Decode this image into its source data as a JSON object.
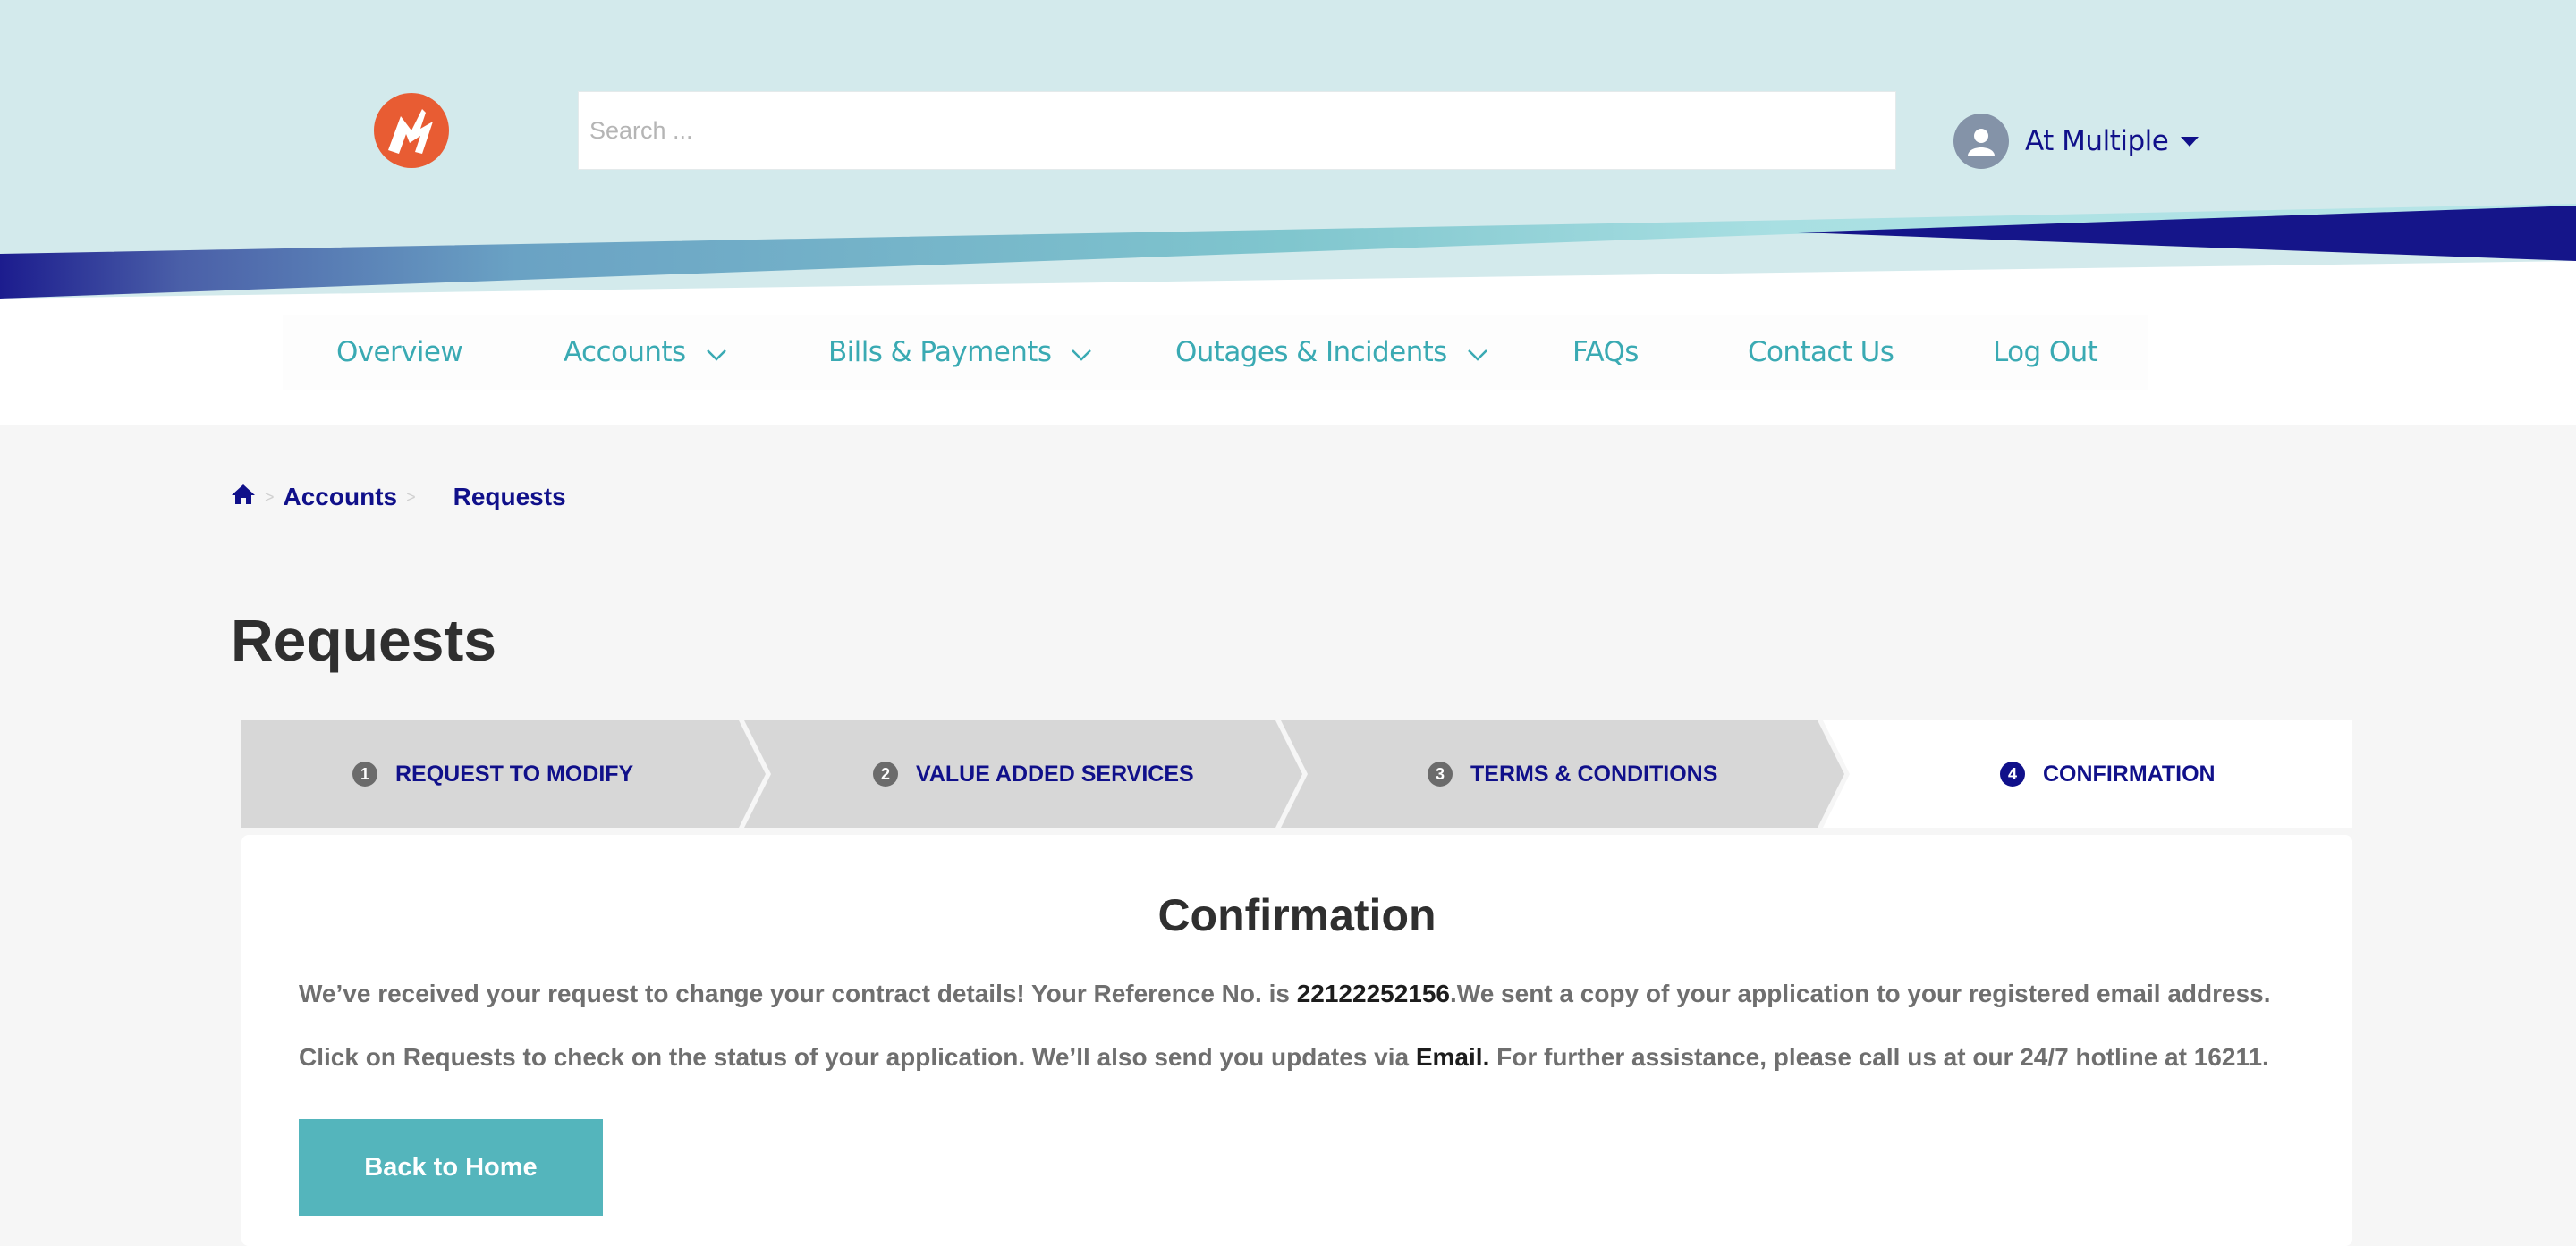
{
  "header": {
    "logo_icon": "lightning-m-logo-icon",
    "search": {
      "placeholder": "Search ...",
      "value": ""
    },
    "user": {
      "name": "At Multiple",
      "avatar_icon": "user-avatar-icon"
    }
  },
  "nav": {
    "items": [
      {
        "label": "Overview",
        "has_dropdown": false
      },
      {
        "label": "Accounts",
        "has_dropdown": true
      },
      {
        "label": "Bills & Payments",
        "has_dropdown": true
      },
      {
        "label": "Outages & Incidents",
        "has_dropdown": true
      },
      {
        "label": "FAQs",
        "has_dropdown": false
      },
      {
        "label": "Contact Us",
        "has_dropdown": false
      },
      {
        "label": "Log Out",
        "has_dropdown": false
      }
    ]
  },
  "breadcrumb": {
    "home_icon": "home-icon",
    "items": [
      "Accounts",
      "Requests"
    ]
  },
  "page": {
    "title": "Requests"
  },
  "steps": [
    {
      "number": "1",
      "label": "REQUEST TO MODIFY",
      "active": false
    },
    {
      "number": "2",
      "label": "VALUE ADDED SERVICES",
      "active": false
    },
    {
      "number": "3",
      "label": "TERMS & CONDITIONS",
      "active": false
    },
    {
      "number": "4",
      "label": "CONFIRMATION",
      "active": true
    }
  ],
  "confirmation": {
    "title": "Confirmation",
    "line1_prefix": "We’ve received your request to change your contract details! Your Reference No. is ",
    "reference_no": "22122252156",
    "line1_suffix": ".We sent a copy of your application to your registered email address.",
    "line2_prefix": "Click on Requests to check on the status of your application. We’ll also send you updates via ",
    "channel": "Email.",
    "line2_suffix": " For further assistance, please call us at our 24/7 hotline at 16211.",
    "button_label": "Back to Home"
  },
  "colors": {
    "header_bg": "#d3eaec",
    "brand_navy": "#10108a",
    "brand_teal": "#3aaab3",
    "button_teal": "#54b5bc",
    "logo_orange": "#e85c33",
    "page_bg": "#f6f6f6"
  }
}
